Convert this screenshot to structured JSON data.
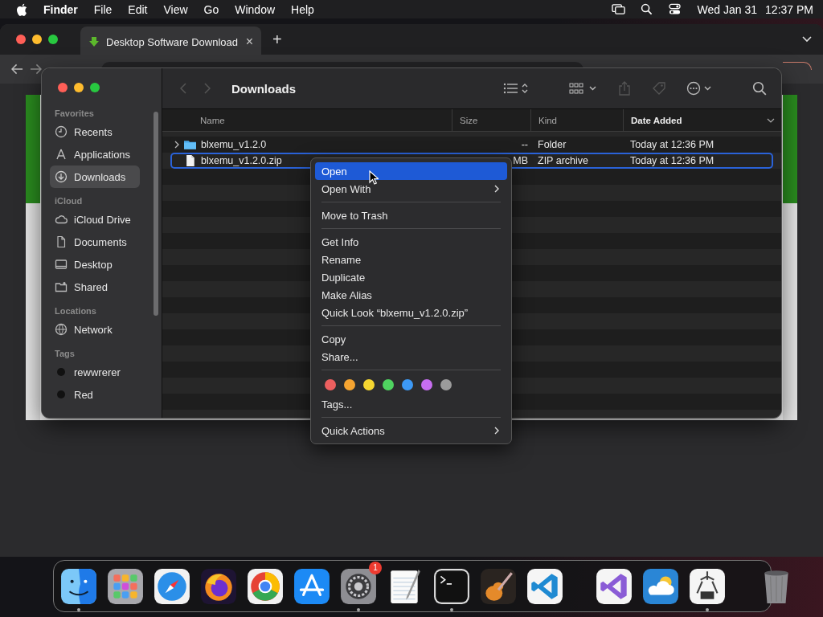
{
  "menu_bar": {
    "app": "Finder",
    "menus": [
      "File",
      "Edit",
      "View",
      "Go",
      "Window",
      "Help"
    ],
    "date": "Wed Jan 31",
    "time": "12:37 PM"
  },
  "browser": {
    "tab": {
      "title": "Desktop Software Download",
      "close": "×"
    },
    "new_tab": "+"
  },
  "finder": {
    "title": "Downloads",
    "sidebar": [
      {
        "heading": "Favorites",
        "items": [
          {
            "label": "Recents",
            "kind": "clock",
            "selected": false
          },
          {
            "label": "Applications",
            "kind": "apps",
            "selected": false
          },
          {
            "label": "Downloads",
            "kind": "download",
            "selected": true
          }
        ]
      },
      {
        "heading": "iCloud",
        "items": [
          {
            "label": "iCloud Drive",
            "kind": "cloud",
            "selected": false
          },
          {
            "label": "Documents",
            "kind": "doc",
            "selected": false
          },
          {
            "label": "Desktop",
            "kind": "desktop",
            "selected": false
          },
          {
            "label": "Shared",
            "kind": "shared",
            "selected": false
          }
        ]
      },
      {
        "heading": "Locations",
        "items": [
          {
            "label": "Network",
            "kind": "globe",
            "selected": false
          }
        ]
      },
      {
        "heading": "Tags",
        "items": [
          {
            "label": "rewwrerer",
            "kind": "tag",
            "color": "#111111",
            "selected": false
          },
          {
            "label": "Red",
            "kind": "tag",
            "color": "#111111",
            "selected": false
          }
        ]
      }
    ],
    "columns": [
      {
        "label": "Name",
        "sorted": false
      },
      {
        "label": "Size",
        "sorted": false
      },
      {
        "label": "Kind",
        "sorted": false
      },
      {
        "label": "Date Added",
        "sorted": true
      }
    ],
    "rows": [
      {
        "name": "blxemu_v1.2.0",
        "expandable": true,
        "size": "--",
        "kind": "Folder",
        "date": "Today at 12:36 PM",
        "selected": false
      },
      {
        "name": "blxemu_v1.2.0.zip",
        "expandable": false,
        "size": "MB",
        "kind": "ZIP archive",
        "date": "Today at 12:36 PM",
        "selected": true
      }
    ]
  },
  "context_menu": [
    {
      "kind": "item",
      "label": "Open",
      "submenu": false,
      "selected": true
    },
    {
      "kind": "item",
      "label": "Open With",
      "submenu": true,
      "selected": false
    },
    {
      "kind": "separator"
    },
    {
      "kind": "item",
      "label": "Move to Trash",
      "submenu": false,
      "selected": false
    },
    {
      "kind": "separator"
    },
    {
      "kind": "item",
      "label": "Get Info",
      "submenu": false,
      "selected": false
    },
    {
      "kind": "item",
      "label": "Rename",
      "submenu": false,
      "selected": false
    },
    {
      "kind": "item",
      "label": "Duplicate",
      "submenu": false,
      "selected": false
    },
    {
      "kind": "item",
      "label": "Make Alias",
      "submenu": false,
      "selected": false
    },
    {
      "kind": "item",
      "label": "Quick Look “blxemu_v1.2.0.zip”",
      "submenu": false,
      "selected": false
    },
    {
      "kind": "separator"
    },
    {
      "kind": "item",
      "label": "Copy",
      "submenu": false,
      "selected": false
    },
    {
      "kind": "item",
      "label": "Share...",
      "submenu": false,
      "selected": false
    },
    {
      "kind": "separator"
    },
    {
      "kind": "colors",
      "tags": [
        {
          "color": "#ec5f5f"
        },
        {
          "color": "#f5a431"
        },
        {
          "color": "#f5d631"
        },
        {
          "color": "#4fd360"
        },
        {
          "color": "#3d99f5"
        },
        {
          "color": "#c76ef0"
        },
        {
          "color": "#9b9b9b"
        }
      ]
    },
    {
      "kind": "item",
      "label": "Tags...",
      "submenu": false,
      "selected": false
    },
    {
      "kind": "separator"
    },
    {
      "kind": "item",
      "label": "Quick Actions",
      "submenu": true,
      "selected": false
    }
  ],
  "dock": [
    {
      "kind": "face",
      "running": true
    },
    {
      "kind": "grid",
      "running": false
    },
    {
      "kind": "compass",
      "running": false
    },
    {
      "kind": "fox",
      "running": false
    },
    {
      "kind": "ring",
      "running": false
    },
    {
      "kind": "triangle",
      "running": false
    },
    {
      "kind": "gear",
      "running": true,
      "badge": "1"
    },
    {
      "kind": "notepad",
      "running": false
    },
    {
      "kind": "terminal",
      "running": true
    },
    {
      "kind": "guitar",
      "running": false
    },
    {
      "kind": "bracket",
      "running": false
    },
    {
      "kind": "divider"
    },
    {
      "kind": "purple-bracket",
      "running": false
    },
    {
      "kind": "cloud",
      "running": false
    },
    {
      "kind": "chip",
      "running": true
    },
    {
      "kind": "divider"
    },
    {
      "kind": "trash",
      "running": false
    }
  ]
}
